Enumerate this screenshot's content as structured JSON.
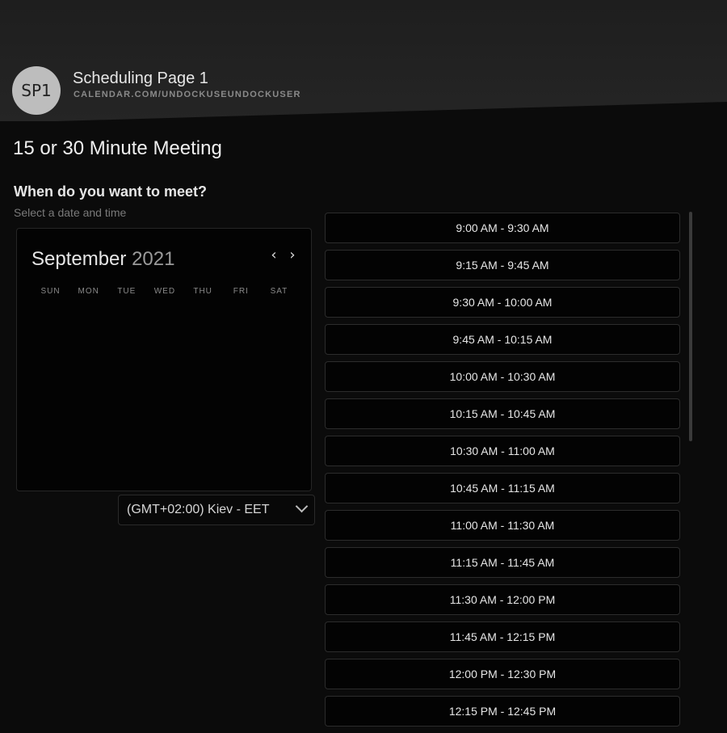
{
  "profile": {
    "avatar_initials": "SP1",
    "page_name": "Scheduling Page 1",
    "page_url": "CALENDAR.COM/UNDOCKUSEUNDOCKUSER"
  },
  "meeting": {
    "title": "15 or 30 Minute Meeting",
    "question": "When do you want to meet?",
    "subtext": "Select a date and time"
  },
  "calendar": {
    "month": "September",
    "year": "2021",
    "prev_icon": "chevron-left-icon",
    "next_icon": "chevron-right-icon",
    "prev_glyph": "‹",
    "next_glyph": "›",
    "weekdays": [
      "SUN",
      "MON",
      "TUE",
      "WED",
      "THU",
      "FRI",
      "SAT"
    ]
  },
  "timezone": {
    "selected": "(GMT+02:00) Kiev - EET",
    "icon": "chevron-down-icon"
  },
  "time_slots": [
    "9:00 AM - 9:30 AM",
    "9:15 AM - 9:45 AM",
    "9:30 AM - 10:00 AM",
    "9:45 AM - 10:15 AM",
    "10:00 AM - 10:30 AM",
    "10:15 AM - 10:45 AM",
    "10:30 AM - 11:00 AM",
    "10:45 AM - 11:15 AM",
    "11:00 AM - 11:30 AM",
    "11:15 AM - 11:45 AM",
    "11:30 AM - 12:00 PM",
    "11:45 AM - 12:15 PM",
    "12:00 PM - 12:30 PM",
    "12:15 PM - 12:45 PM"
  ]
}
